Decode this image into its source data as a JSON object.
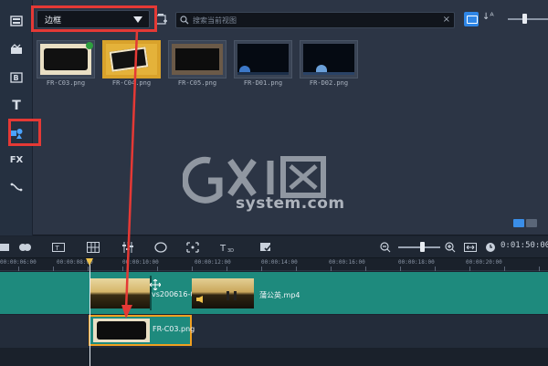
{
  "library": {
    "category_value": "边框",
    "search_placeholder": "搜索当前视图",
    "clear_label": "×",
    "sort_label": "↓ᴬ",
    "thumbnails": [
      {
        "label": "FR-C03.png"
      },
      {
        "label": "FR-C04.png"
      },
      {
        "label": "FR-C05.png"
      },
      {
        "label": "FR-D01.png"
      },
      {
        "label": "FR-D02.png"
      }
    ]
  },
  "left_toolbar": {
    "title_label": "T",
    "fx_label": "FX"
  },
  "watermark": {
    "sub": "system.com"
  },
  "timeline": {
    "timecode": "0:01:50:00",
    "ruler_labels": [
      "00:00:06:00",
      "00:00:08:00",
      "00:00:10:00",
      "00:00:12:00",
      "00:00:14:00",
      "00:00:16:00",
      "00:00:18:00",
      "00:00:20:00"
    ],
    "video_clips": [
      {
        "label": "vs200616-0"
      },
      {
        "label": "蒲公英.mp4"
      }
    ],
    "overlay_clip": {
      "label": "FR-C03.png"
    }
  },
  "colors": {
    "highlight": "#e53935",
    "track_video": "#1e8a7d",
    "accent": "#2f86e6"
  }
}
